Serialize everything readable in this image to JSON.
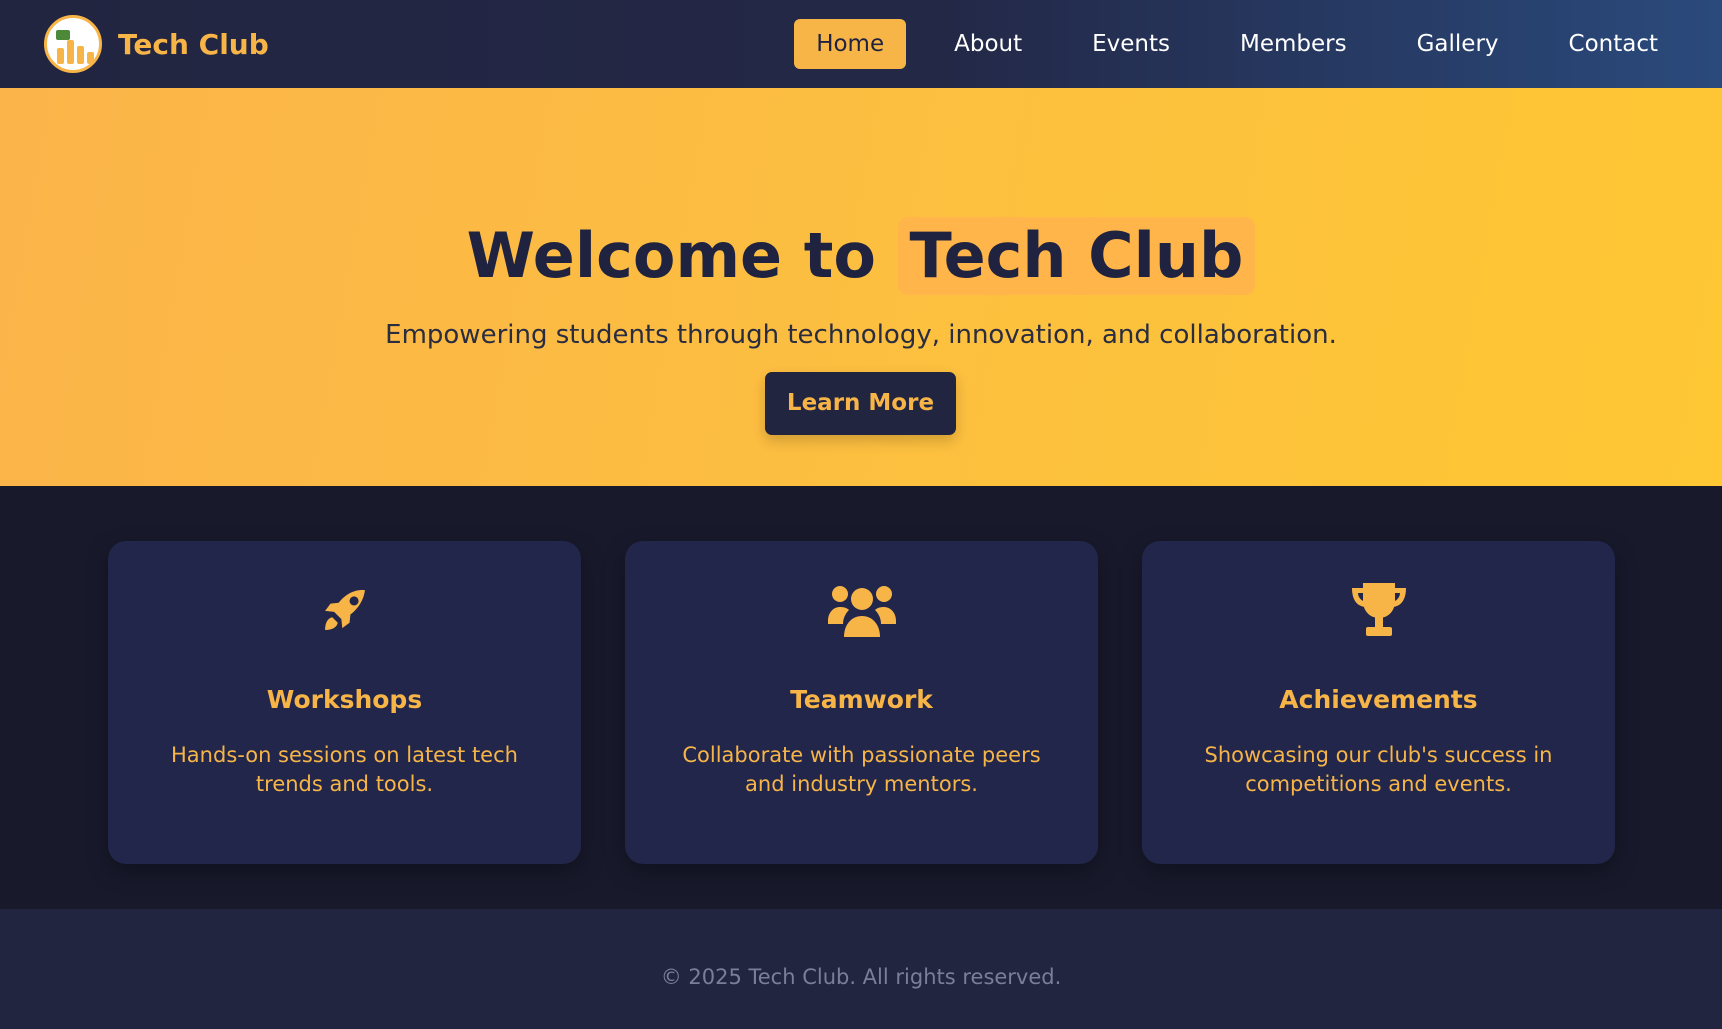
{
  "brand": {
    "name": "Tech Club",
    "logo_icon": "club-logo-icon"
  },
  "nav": {
    "items": [
      {
        "label": "Home",
        "active": true
      },
      {
        "label": "About",
        "active": false
      },
      {
        "label": "Events",
        "active": false
      },
      {
        "label": "Members",
        "active": false
      },
      {
        "label": "Gallery",
        "active": false
      },
      {
        "label": "Contact",
        "active": false
      }
    ]
  },
  "hero": {
    "title_prefix": "Welcome to",
    "title_highlight": "Tech Club",
    "subtitle": "Empowering students through technology, innovation, and collaboration.",
    "cta_label": "Learn More"
  },
  "features": [
    {
      "icon": "rocket-icon",
      "title": "Workshops",
      "text": "Hands-on sessions on latest tech trends and tools."
    },
    {
      "icon": "users-icon",
      "title": "Teamwork",
      "text": "Collaborate with passionate peers and industry mentors."
    },
    {
      "icon": "trophy-icon",
      "title": "Achievements",
      "text": "Showcasing our club's success in competitions and events."
    }
  ],
  "footer": {
    "text": "© 2025 Tech Club. All rights reserved."
  },
  "colors": {
    "accent": "#f7b548",
    "navy": "#222540",
    "background": "#181a2c",
    "hero_gradient_start": "#fbb44a",
    "hero_gradient_end": "#fec733"
  }
}
